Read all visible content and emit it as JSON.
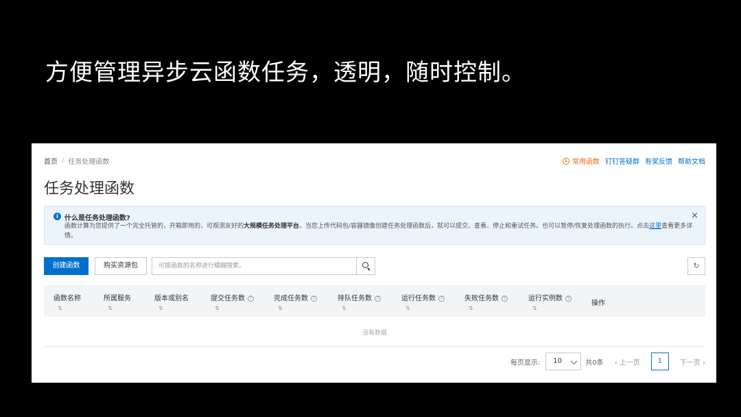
{
  "slide": {
    "title": "方便管理异步云函数任务，透明，随时控制。"
  },
  "breadcrumb": {
    "home": "首页",
    "sep": "/",
    "current": "任务处理函数"
  },
  "toplinks": {
    "common": "常用函数",
    "dingtalk": "钉钉答疑群",
    "feedback": "有奖反馈",
    "docs": "帮助文档"
  },
  "page": {
    "title": "任务处理函数"
  },
  "notice": {
    "title": "什么是任务处理函数?",
    "body_1": "函数计算为您提供了一个完全托管的，开箱即用的，可观测友好的",
    "body_bold": "大规模任务处理平台",
    "body_2": "。当您上传代码包/容器镜像创建任务处理函数后，就可以提交、查看、停止和重试任务。也可以暂停/恢复处理函数的执行。点击",
    "link": "这里",
    "body_3": "查看更多详情。",
    "close": "×"
  },
  "toolbar": {
    "create_label": "创建函数",
    "buy_label": "购买资源包",
    "search_placeholder": "可按函数的名称进行模糊搜索。",
    "refresh": "↻"
  },
  "table": {
    "sort_glyph": "⇅",
    "help_glyph": "?",
    "columns": [
      "函数名称",
      "所属服务",
      "版本或别名",
      "提交任务数",
      "完成任务数",
      "排队任务数",
      "运行任务数",
      "失败任务数",
      "运行实例数",
      "操作"
    ],
    "empty_text": "没有数据"
  },
  "pager": {
    "page_size_label": "每页显示:",
    "page_size": "10",
    "total": "共0条",
    "prev": "‹ 上一页",
    "current_page": "1",
    "next": "下一页 ›"
  },
  "colors": {
    "primary": "#0070cc",
    "accent": "#ed6a0c",
    "notice_bg": "#ebf3fb"
  }
}
